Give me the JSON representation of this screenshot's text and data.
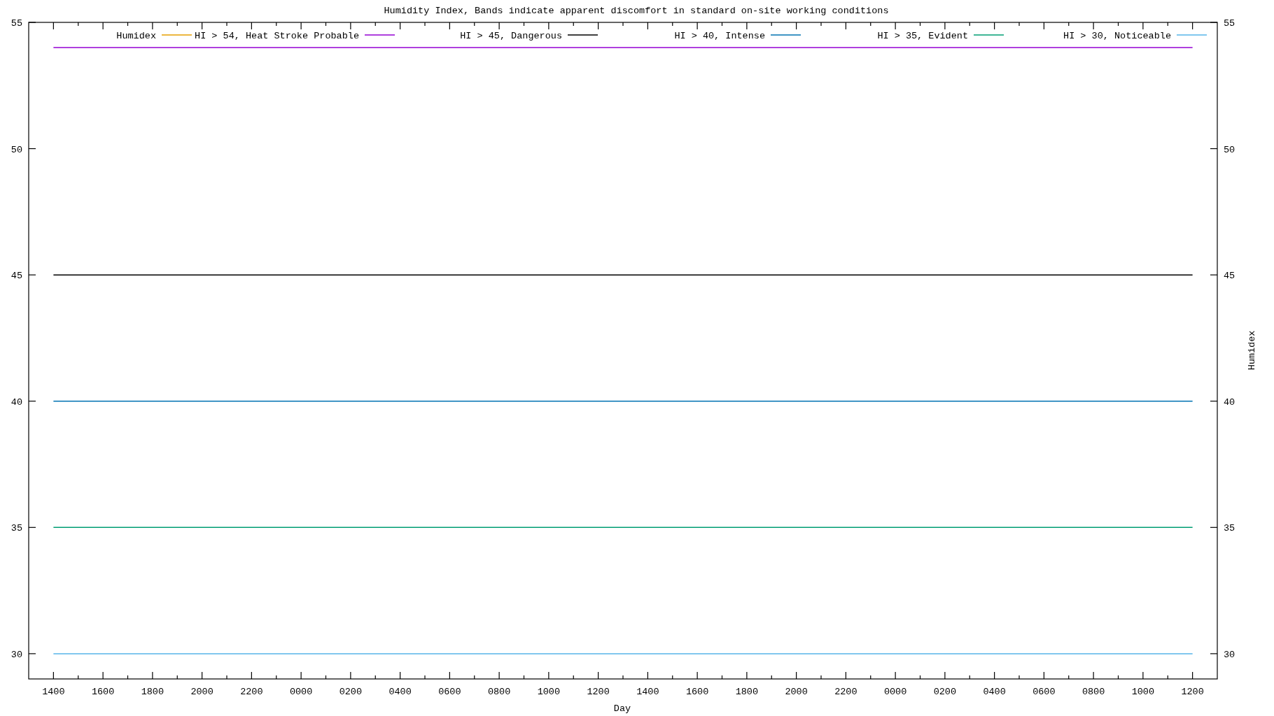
{
  "plot": {
    "chart_data": {
      "type": "line",
      "title": "Humidity Index, Bands indicate apparent discomfort in standard on-site working conditions",
      "xlabel": "Day",
      "y2label": "Humidex",
      "legend": true,
      "categories": [
        "1400",
        "1600",
        "1800",
        "2000",
        "2200",
        "0000",
        "0200",
        "0400",
        "0600",
        "0800",
        "1000",
        "1200",
        "1400",
        "1600",
        "1800",
        "2000",
        "2200",
        "0000",
        "0200",
        "0400",
        "0600",
        "0800",
        "1000",
        "1200"
      ],
      "ylim": [
        29,
        55
      ],
      "yticks": [
        30,
        35,
        40,
        45,
        50,
        55
      ],
      "y2lim": [
        29,
        55
      ],
      "y2ticks": [
        30,
        35,
        40,
        45,
        50,
        55
      ],
      "series": [
        {
          "name": "Humidex",
          "color": "#e69f00",
          "values": [
            null,
            null,
            null,
            null,
            null,
            null,
            null,
            null,
            null,
            null,
            null,
            null,
            null,
            null,
            null,
            null,
            null,
            null,
            null,
            null,
            null,
            null,
            null,
            null
          ]
        },
        {
          "name": "HI > 54, Heat Stroke Probable",
          "color": "#9400d3",
          "values": [
            54,
            54,
            54,
            54,
            54,
            54,
            54,
            54,
            54,
            54,
            54,
            54,
            54,
            54,
            54,
            54,
            54,
            54,
            54,
            54,
            54,
            54,
            54,
            54
          ]
        },
        {
          "name": "HI > 45, Dangerous",
          "color": "#000000",
          "values": [
            45,
            45,
            45,
            45,
            45,
            45,
            45,
            45,
            45,
            45,
            45,
            45,
            45,
            45,
            45,
            45,
            45,
            45,
            45,
            45,
            45,
            45,
            45,
            45
          ]
        },
        {
          "name": "HI > 40, Intense",
          "color": "#0072b2",
          "values": [
            40,
            40,
            40,
            40,
            40,
            40,
            40,
            40,
            40,
            40,
            40,
            40,
            40,
            40,
            40,
            40,
            40,
            40,
            40,
            40,
            40,
            40,
            40,
            40
          ]
        },
        {
          "name": "HI > 35, Evident",
          "color": "#009e73",
          "values": [
            35,
            35,
            35,
            35,
            35,
            35,
            35,
            35,
            35,
            35,
            35,
            35,
            35,
            35,
            35,
            35,
            35,
            35,
            35,
            35,
            35,
            35,
            35,
            35
          ]
        },
        {
          "name": "HI > 30, Noticeable",
          "color": "#56b4e9",
          "values": [
            30,
            30,
            30,
            30,
            30,
            30,
            30,
            30,
            30,
            30,
            30,
            30,
            30,
            30,
            30,
            30,
            30,
            30,
            30,
            30,
            30,
            30,
            30,
            30
          ]
        }
      ]
    }
  }
}
